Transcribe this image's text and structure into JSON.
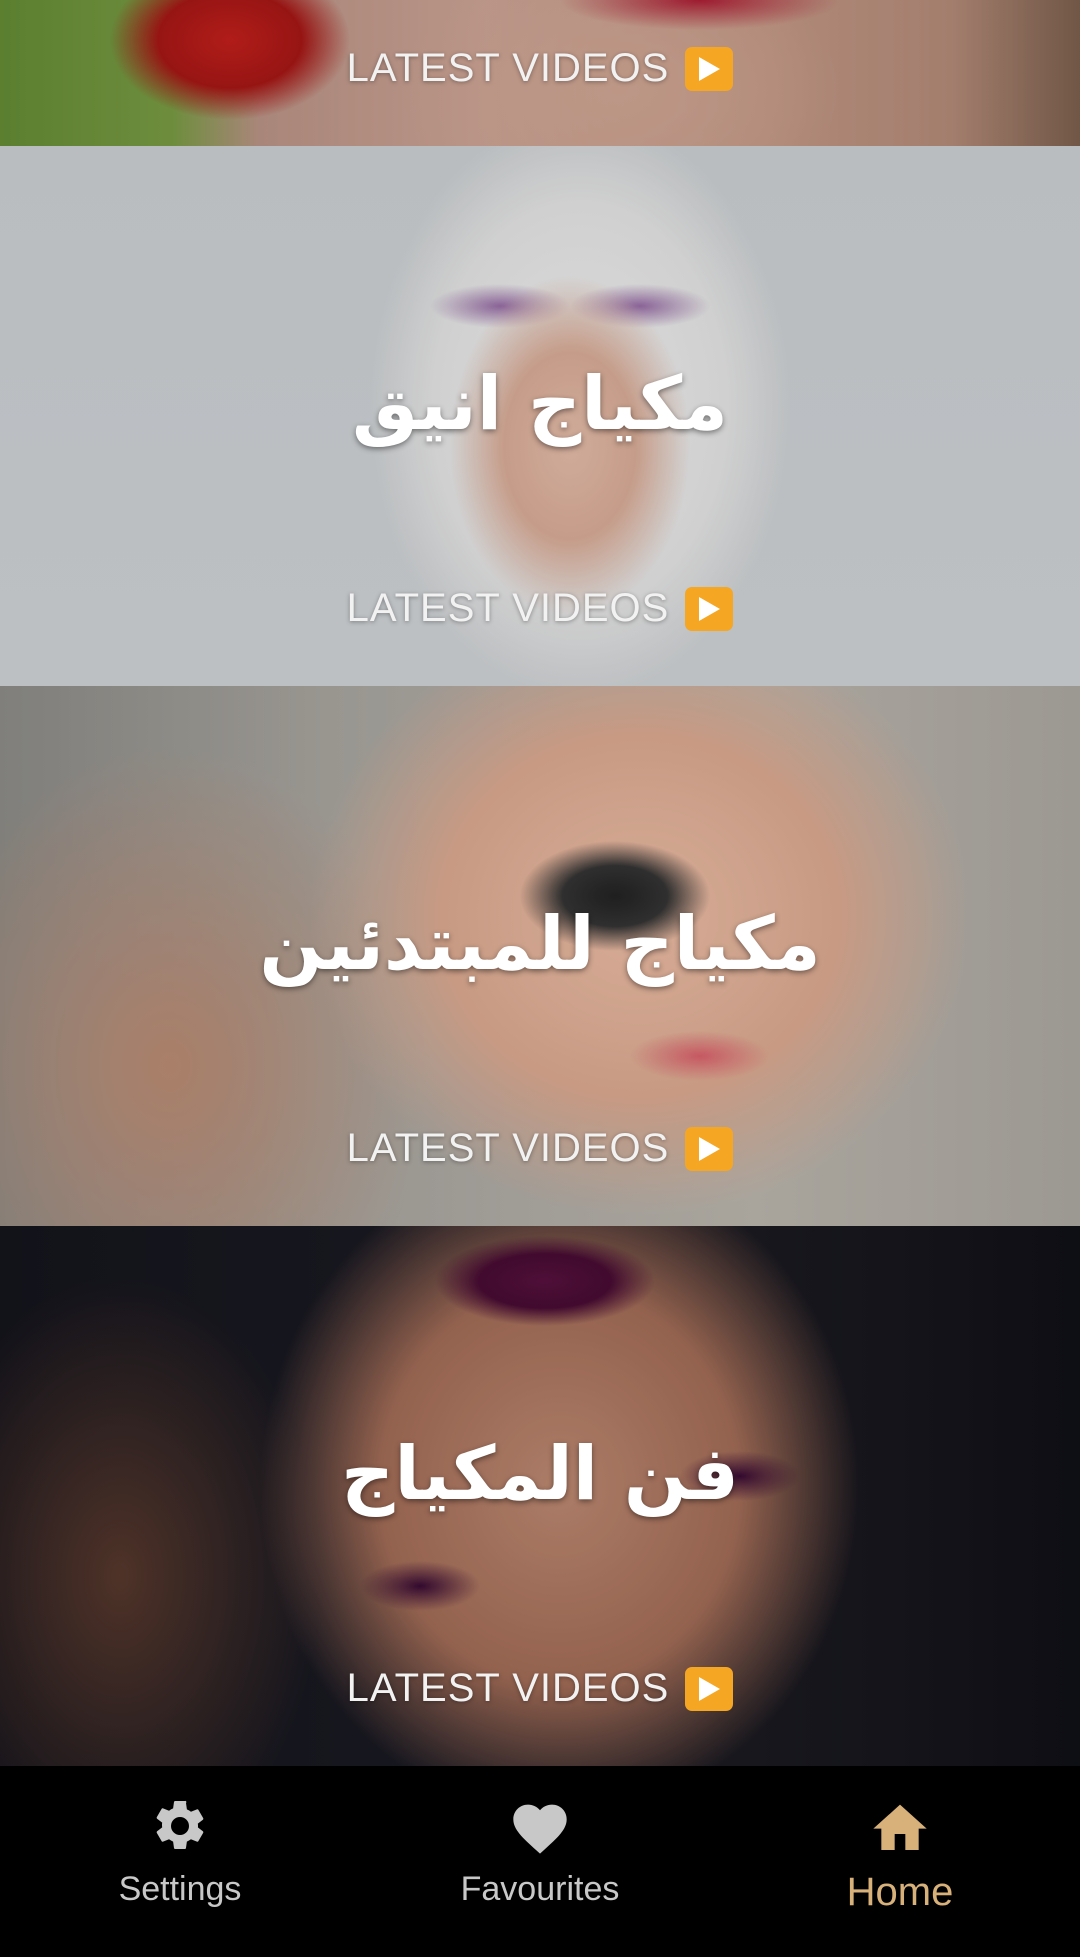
{
  "cards": [
    {
      "title": "",
      "button_label": "LATEST VIDEOS",
      "button_icon": "play-button-icon",
      "photo": "woman-red-lips-closeup"
    },
    {
      "title": "مكياج انيق",
      "button_label": "LATEST VIDEOS",
      "button_icon": "play-button-icon",
      "photo": "woman-white-hood-purple-eyeshadow"
    },
    {
      "title": "مكياج للمبتدئين",
      "button_label": "LATEST VIDEOS",
      "button_icon": "play-button-icon",
      "photo": "woman-applying-blush-brush"
    },
    {
      "title": "فن المكياج",
      "button_label": "LATEST VIDEOS",
      "button_icon": "play-button-icon",
      "photo": "woman-purple-lips-nails"
    }
  ],
  "bottom_nav": {
    "items": [
      {
        "label": "Settings",
        "icon": "gear-icon",
        "active": false
      },
      {
        "label": "Favourites",
        "icon": "heart-icon",
        "active": false
      },
      {
        "label": "Home",
        "icon": "home-icon",
        "active": true
      }
    ]
  },
  "colors": {
    "accent": "#d7b07a",
    "play_button": "#f5a623",
    "nav_background": "#000000",
    "nav_inactive": "#c8c8c8"
  }
}
